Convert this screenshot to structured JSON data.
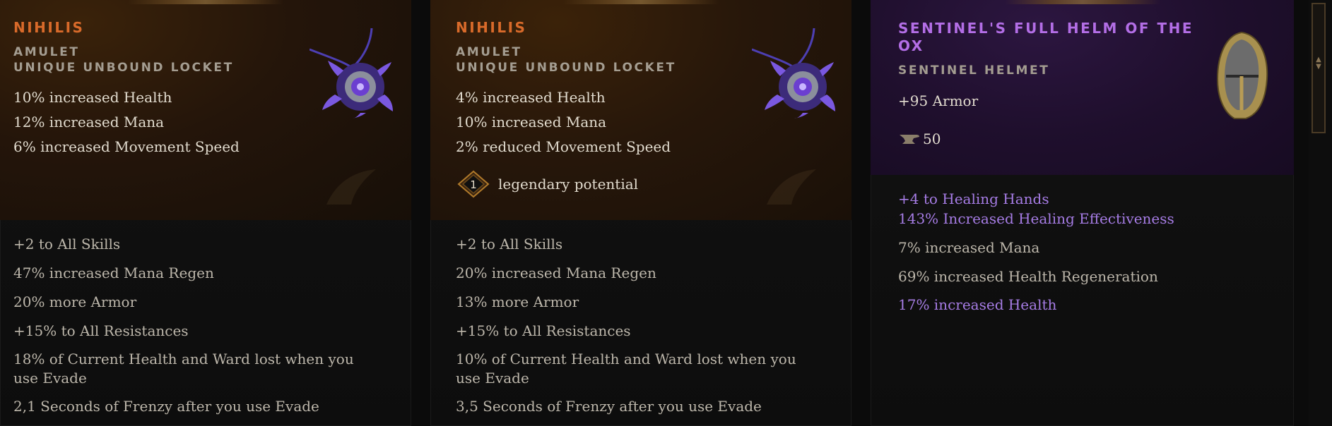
{
  "cards": [
    {
      "name": "NIHILIS",
      "type": "AMULET",
      "rarity": "UNIQUE UNBOUND LOCKET",
      "implicits": [
        "10% increased Health",
        "12% increased Mana",
        "6% increased Movement Speed"
      ],
      "mods": [
        "+2 to All Skills",
        "47% increased Mana Regen",
        "20% more Armor",
        "+15% to All Resistances",
        "18% of Current Health and Ward lost when you use Evade",
        "2,1 Seconds of Frenzy after you use Evade"
      ],
      "icon": "amulet-icon"
    },
    {
      "name": "NIHILIS",
      "type": "AMULET",
      "rarity": "UNIQUE UNBOUND LOCKET",
      "implicits": [
        "4% increased Health",
        "10% increased Mana",
        "2% reduced Movement Speed"
      ],
      "legendary_potential_value": "1",
      "legendary_potential_label": "legendary potential",
      "mods": [
        "+2 to All Skills",
        "20% increased Mana Regen",
        "13% more Armor",
        "+15% to All Resistances",
        "10% of Current Health and Ward lost when you use Evade",
        "3,5 Seconds of Frenzy after you use Evade"
      ],
      "icon": "amulet-icon"
    },
    {
      "name": "SENTINEL'S FULL HELM OF THE OX",
      "type": "SENTINEL HELMET",
      "implicits": [
        "+95 Armor"
      ],
      "forge_potential": "50",
      "set_mods": [
        "+4 to Healing Hands",
        "143% Increased Healing Effectiveness"
      ],
      "mods": [
        "7% increased Mana",
        "69% increased Health Regeneration"
      ],
      "purple_mods": [
        "17% increased Health"
      ],
      "icon": "helmet-icon"
    }
  ],
  "colors": {
    "unique": "#d86a2a",
    "set": "#b36ee6",
    "affix_purple": "#a77de6",
    "text": "#e2dccf"
  }
}
